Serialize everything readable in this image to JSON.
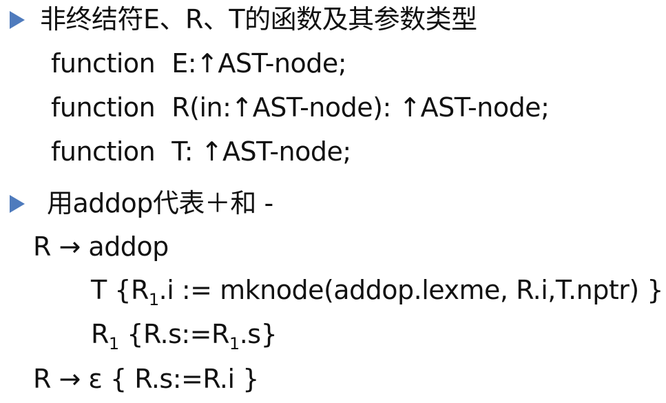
{
  "bullet_color": "#4f7bbd",
  "bullets": [
    {
      "text": "非终结符E、R、T的函数及其参数类型"
    },
    {
      "text": "用addop代表＋和 -"
    }
  ],
  "functions": [
    {
      "keyword": "function",
      "signature": "E:↑AST-node;"
    },
    {
      "keyword": "function",
      "signature": "R(in:↑AST-node): ↑AST-node;"
    },
    {
      "keyword": "function",
      "signature": "T: ↑AST-node;"
    }
  ],
  "rule1": {
    "head": "R → addop",
    "line2_a": "T {R",
    "line2_sub": "1",
    "line2_b": ".i := mknode(addop.lexme,  R.i,T.nptr) }",
    "line3_a": "R",
    "line3_sub": "1",
    "line3_b": " {R.s:=R",
    "line3_sub2": "1",
    "line3_c": ".s}"
  },
  "rule2": {
    "text": "R → ε { R.s:=R.i }"
  }
}
